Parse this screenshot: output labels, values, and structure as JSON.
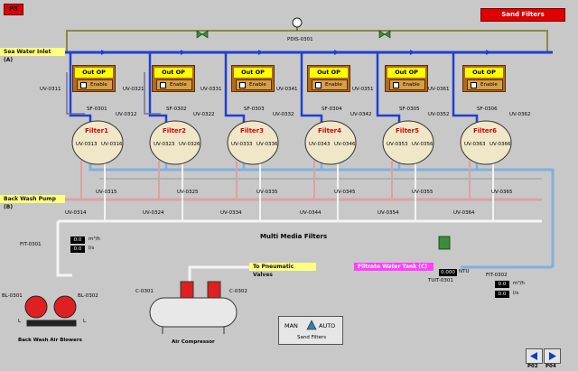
{
  "screen": {
    "id": "P3",
    "title": "Sand Filters"
  },
  "labels": {
    "sea_water_inlet": "Sea Water Inlet (A)",
    "back_wash_pump": "Back Wash Pump (B)",
    "filtrate_tank": "Filtrate Water Tank (C)",
    "pneumatic": "To Pneumatic Valves",
    "multi_media": "Multi Media Filters",
    "back_wash_blowers": "Back Wash Air Blowers",
    "air_compressor": "Air Compressor",
    "pdis": "PDIS-0301",
    "fit1": "FIT-0301",
    "fit2": "FIT-0302",
    "tuit": "TUIT-0301",
    "bl1": "BL-0301",
    "bl2": "BL-0302",
    "c1": "C-0301",
    "c2": "C-0302",
    "ntu": "NTU",
    "l_left": "L",
    "l_right": "L"
  },
  "filters": [
    {
      "tag": "SF-0301",
      "name": "Filter1",
      "uv_in": "UV-0311",
      "uv_top": "UV-0312",
      "uv_a": "UV-0313",
      "uv_b": "UV-0316",
      "uv_c": "UV-0315",
      "uv_d": "UV-0314",
      "uv_out": "UV-0321"
    },
    {
      "tag": "SF-0302",
      "name": "Filter2",
      "uv_in": "UV-0321",
      "uv_top": "UV-0322",
      "uv_a": "UV-0323",
      "uv_b": "UV-0326",
      "uv_c": "UV-0325",
      "uv_d": "UV-0324",
      "uv_out": "UV-0331"
    },
    {
      "tag": "SF-0303",
      "name": "Filter3",
      "uv_in": "UV-0331",
      "uv_top": "UV-0332",
      "uv_a": "UV-0333",
      "uv_b": "UV-0336",
      "uv_c": "UV-0335",
      "uv_d": "UV-0334",
      "uv_out": "UV-0341"
    },
    {
      "tag": "SF-0304",
      "name": "Filter4",
      "uv_in": "UV-0341",
      "uv_top": "UV-0342",
      "uv_a": "UV-0343",
      "uv_b": "UV-0346",
      "uv_c": "UV-0345",
      "uv_d": "UV-0344",
      "uv_out": "UV-0351"
    },
    {
      "tag": "SF-0305",
      "name": "Filter5",
      "uv_in": "UV-0351",
      "uv_top": "UV-0352",
      "uv_a": "UV-0353",
      "uv_b": "UV-0356",
      "uv_c": "UV-0355",
      "uv_d": "UV-0354",
      "uv_out": "UV-0361"
    },
    {
      "tag": "SF-0306",
      "name": "Filter6",
      "uv_in": "UV-0361",
      "uv_top": "UV-0362",
      "uv_a": "UV-0363",
      "uv_b": "UV-0366",
      "uv_c": "UV-0365",
      "uv_d": "UV-0364",
      "uv_out": ""
    }
  ],
  "outop": {
    "title": "Out OP",
    "enable": "Enable"
  },
  "readings": {
    "fit1_flow": "0.0",
    "fit1_unit": "m³/h",
    "fit1_total": "0.0",
    "fit1_total_unit": "l/s",
    "fit2_flow": "0.0",
    "fit2_unit": "m³/h",
    "fit2_total": "0.0",
    "fit2_total_unit": "l/s",
    "ntu": "0.000"
  },
  "mode": {
    "man": "MAN",
    "auto": "AUTO",
    "caption": "Sand Filters"
  },
  "nav": {
    "prev": "P02",
    "next": "P04"
  },
  "colors": {
    "header_red": "#e00000",
    "feed_blue": "#2040d0",
    "filtrate_lightblue": "#7fb0e0",
    "backwash_pink": "#e0a0a0",
    "air_white": "#f4f4f4",
    "panel_gray": "#c8c8c8"
  }
}
